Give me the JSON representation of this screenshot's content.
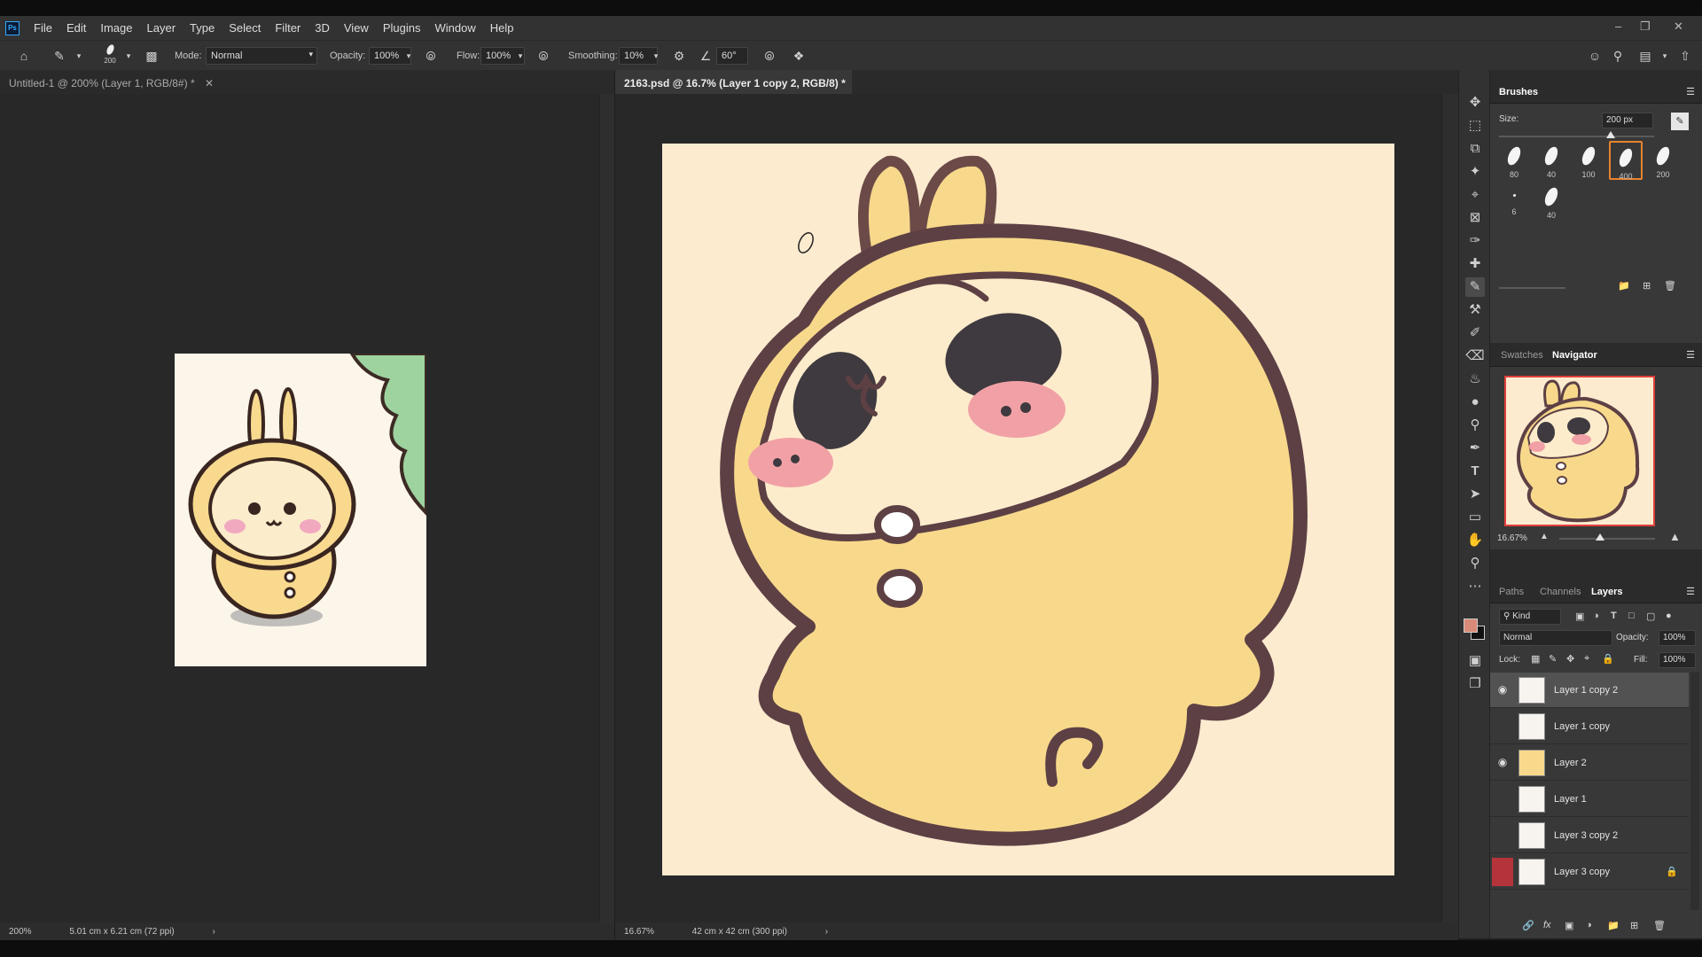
{
  "app": {
    "logo_text": "Ps",
    "menu": [
      "File",
      "Edit",
      "Image",
      "Layer",
      "Type",
      "Select",
      "Filter",
      "3D",
      "View",
      "Plugins",
      "Window",
      "Help"
    ]
  },
  "options_bar": {
    "brush_size": "200",
    "mode_label": "Mode:",
    "mode_value": "Normal",
    "opacity_label": "Opacity:",
    "opacity_value": "100%",
    "flow_label": "Flow:",
    "flow_value": "100%",
    "smoothing_label": "Smoothing:",
    "smoothing_value": "10%",
    "angle_value": "60°"
  },
  "documents": [
    {
      "tab_title": "Untitled-1 @ 200% (Layer 1, RGB/8#) *",
      "zoom": "200%",
      "doc_size": "5.01 cm x 6.21 cm (72 ppi)"
    },
    {
      "tab_title": "2163.psd @ 16.7% (Layer 1 copy 2, RGB/8) *",
      "zoom": "16.67%",
      "doc_size": "42 cm x 42 cm (300 ppi)"
    }
  ],
  "brushes_panel": {
    "title": "Brushes",
    "size_label": "Size:",
    "size_value": "200 px",
    "presets": [
      "80",
      "40",
      "100",
      "400",
      "200",
      "6",
      "40"
    ],
    "selected_preset": "400"
  },
  "navigator_panel": {
    "tabs": [
      "Swatches",
      "Navigator"
    ],
    "active_tab": "Navigator",
    "zoom": "16.67%"
  },
  "layers_panel": {
    "tabs": [
      "Paths",
      "Channels",
      "Layers"
    ],
    "active_tab": "Layers",
    "filter_label": "Kind",
    "blend_mode": "Normal",
    "opacity_label": "Opacity:",
    "opacity_value": "100%",
    "lock_label": "Lock:",
    "fill_label": "Fill:",
    "fill_value": "100%",
    "layers": [
      {
        "name": "Layer 1 copy 2",
        "visible": true,
        "selected": true,
        "locked": false
      },
      {
        "name": "Layer 1 copy",
        "visible": false,
        "selected": false,
        "locked": false
      },
      {
        "name": "Layer 2",
        "visible": true,
        "selected": false,
        "locked": false
      },
      {
        "name": "Layer 1",
        "visible": false,
        "selected": false,
        "locked": false
      },
      {
        "name": "Layer 3 copy 2",
        "visible": false,
        "selected": false,
        "locked": false
      },
      {
        "name": "Layer 3 copy",
        "visible": false,
        "selected": false,
        "locked": true
      }
    ]
  },
  "colors": {
    "foreground": "#d98a78",
    "background": "#111111",
    "accent_selection": "#e8842f",
    "canvas_bg": "#fdebd0"
  }
}
